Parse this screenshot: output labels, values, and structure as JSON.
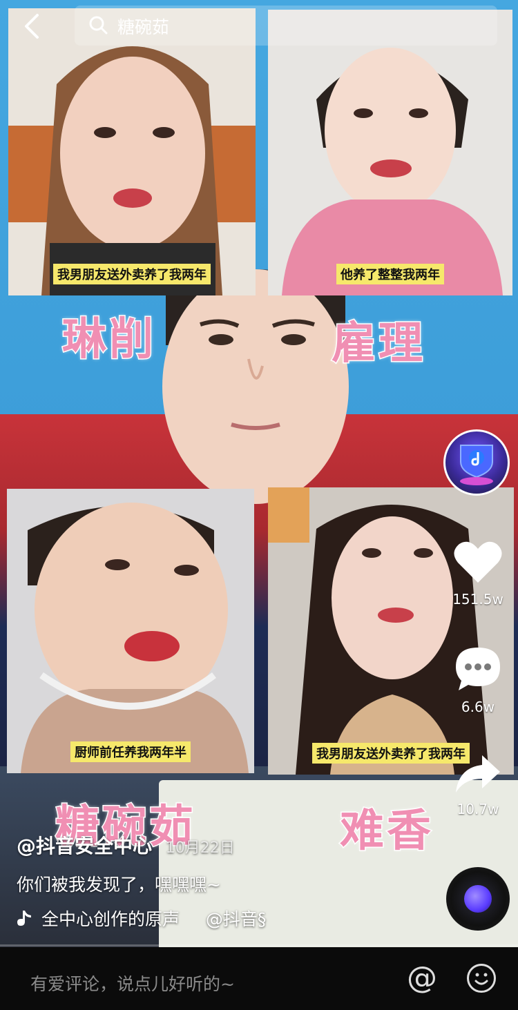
{
  "search": {
    "query": "糖碗茹"
  },
  "tiles": [
    {
      "caption": "我男朋友送外卖养了我两年"
    },
    {
      "caption": "他养了整整我两年"
    },
    {
      "caption": "厨师前任养我两年半"
    },
    {
      "caption": "我男朋友送外卖养了我两年"
    }
  ],
  "overlay_words": [
    "琳削",
    "雇理",
    "糖碗茹",
    "难香"
  ],
  "actions": {
    "like_count": "151.5w",
    "comment_count": "6.6w",
    "share_count": "10.7w"
  },
  "post": {
    "author": "@抖音安全中心",
    "date": "10月22日",
    "description": "你们被我发现了，嘿嘿嘿~",
    "music": "全中心创作的原声",
    "music_author": "@抖音§"
  },
  "comment_bar": {
    "placeholder": "有爱评论，说点儿好听的~"
  },
  "colors": {
    "accent_pink": "#f08fb3",
    "caption_yellow": "#f6e86b",
    "sky": "#45a7e0"
  }
}
